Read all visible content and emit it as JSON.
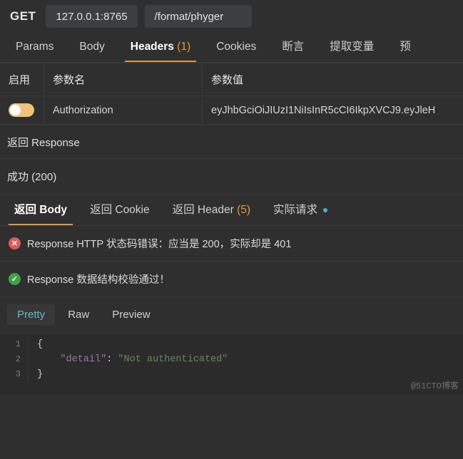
{
  "request_bar": {
    "method": "GET",
    "host": "127.0.0.1:8765",
    "path": "/format/phyger"
  },
  "request_tabs": [
    {
      "label": "Params",
      "active": false
    },
    {
      "label": "Body",
      "active": false
    },
    {
      "label": "Headers",
      "count": "(1)",
      "active": true
    },
    {
      "label": "Cookies",
      "active": false
    },
    {
      "label": "断言",
      "active": false
    },
    {
      "label": "提取变量",
      "active": false
    },
    {
      "label": "预",
      "active": false
    }
  ],
  "params_table": {
    "headers": {
      "enable": "启用",
      "name": "参数名",
      "value": "参数值"
    },
    "rows": [
      {
        "enabled": true,
        "name": "Authorization",
        "value": "eyJhbGciOiJIUzI1NiIsInR5cCI6IkpXVCJ9.eyJleH"
      }
    ]
  },
  "response": {
    "section_title": "返回 Response",
    "status": "成功 (200)",
    "tabs": [
      {
        "label": "返回 Body",
        "active": true
      },
      {
        "label": "返回 Cookie",
        "active": false
      },
      {
        "label": "返回 Header",
        "count": "(5)",
        "active": false
      },
      {
        "label": "实际请求",
        "active": false,
        "dot": true
      }
    ],
    "assertions": [
      {
        "icon": "error-icon",
        "status": "error",
        "symbol": "✕",
        "text": "Response HTTP 状态码错误：应当是 200，实际却是 401"
      },
      {
        "icon": "success-icon",
        "status": "ok",
        "symbol": "✓",
        "text": "Response 数据结构校验通过！"
      }
    ],
    "format_tabs": [
      {
        "label": "Pretty",
        "active": true
      },
      {
        "label": "Raw",
        "active": false
      },
      {
        "label": "Preview",
        "active": false
      }
    ],
    "body_lines": [
      {
        "no": "1",
        "brace": "{",
        "key": "",
        "colon": "",
        "value": ""
      },
      {
        "no": "2",
        "brace": "",
        "key": "\"detail\"",
        "colon": ": ",
        "value": "\"Not authenticated\""
      },
      {
        "no": "3",
        "brace": "}",
        "key": "",
        "colon": "",
        "value": ""
      }
    ]
  },
  "watermark": "@51CTO博客",
  "colors": {
    "accent": "#e09b3d",
    "error": "#e05a5a",
    "success": "#43a047",
    "link": "#6ab7c8"
  }
}
